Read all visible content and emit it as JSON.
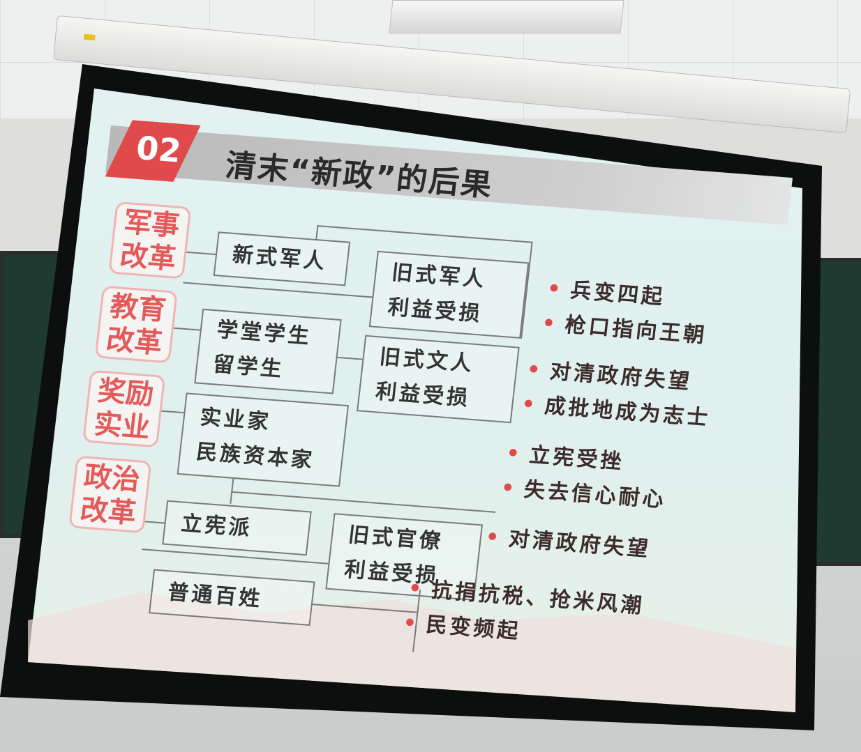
{
  "slide": {
    "number": "02",
    "title": "清末“新政”的后果"
  },
  "categories": {
    "military": "军事\n改革",
    "education": "教育\n改革",
    "industry": "奖励\n实业",
    "politics": "政治\n改革"
  },
  "groups": {
    "new_soldiers": "新式军人",
    "old_soldiers": [
      "旧式军人",
      "利益受损"
    ],
    "students": [
      "学堂学生",
      "留学生"
    ],
    "old_literati": [
      "旧式文人",
      "利益受损"
    ],
    "industrialists": [
      "实业家",
      "民族资本家"
    ],
    "constitutionalists": "立宪派",
    "old_officials": [
      "旧式官僚",
      "利益受损"
    ],
    "commoners": "普通百姓"
  },
  "results": {
    "military": [
      "兵变四起",
      "枪口指向王朝"
    ],
    "education": [
      "对清政府失望",
      "成批地成为志士"
    ],
    "constitution": [
      "立宪受挫",
      "失去信心耐心"
    ],
    "officials": [
      "对清政府失望"
    ],
    "commoners": [
      "抗捐抗税、抢米风潮",
      "民变频起"
    ]
  },
  "bullet": "•"
}
